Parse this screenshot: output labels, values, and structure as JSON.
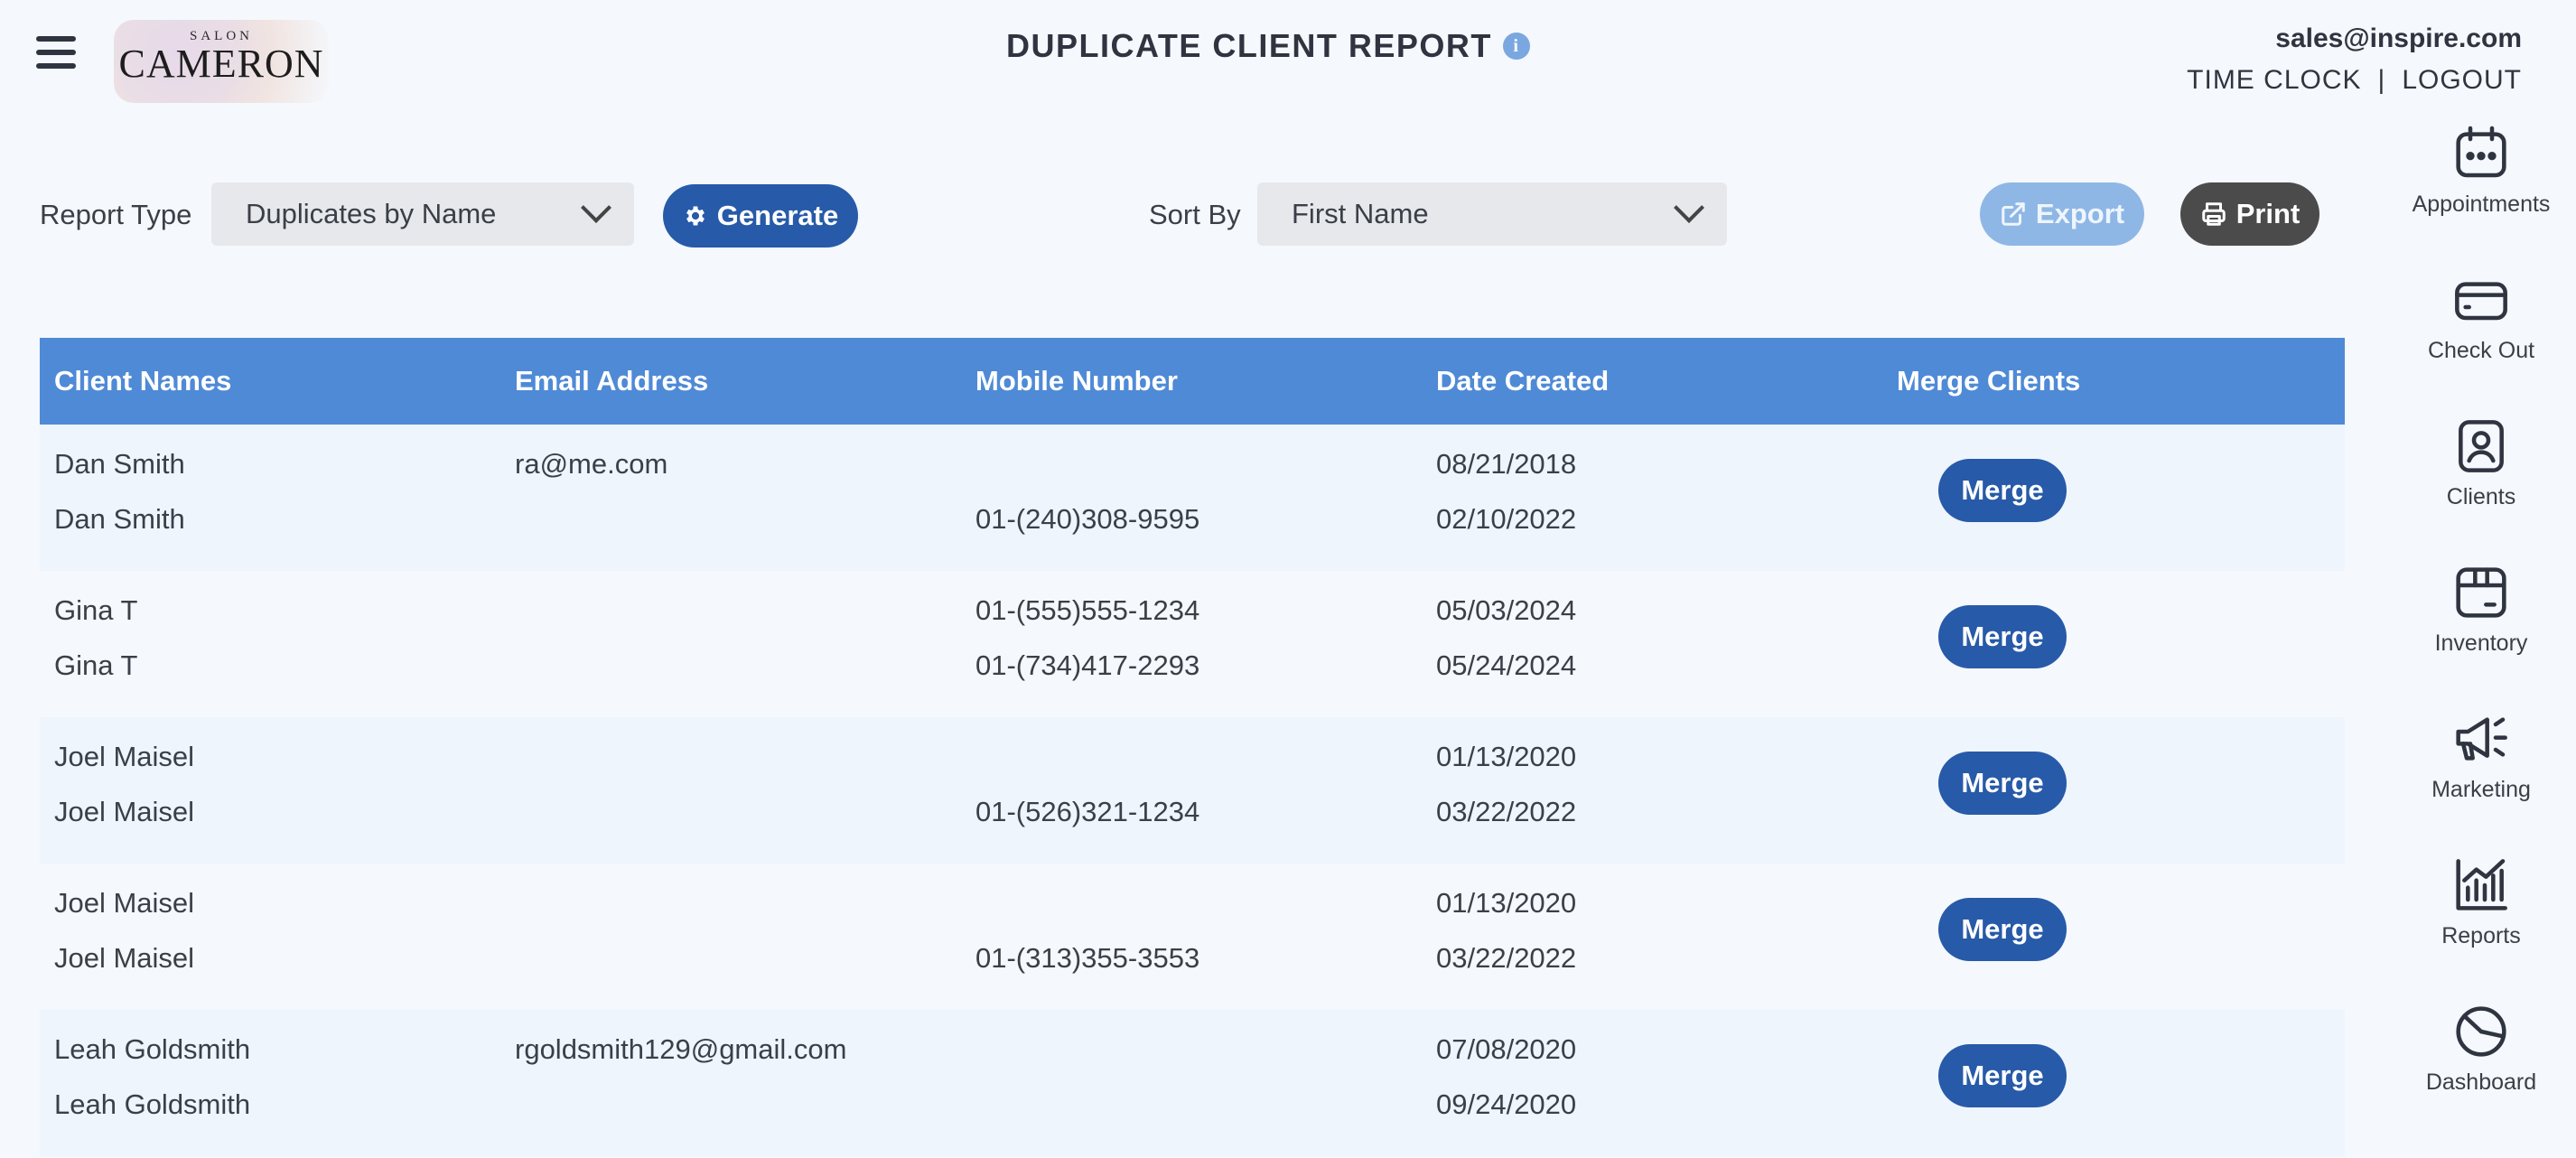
{
  "header": {
    "logo_top": "SALON",
    "logo_main": "CAMERON",
    "title": "DUPLICATE CLIENT REPORT",
    "info_glyph": "i",
    "user_email": "sales@inspire.com",
    "time_clock": "TIME CLOCK",
    "separator": "|",
    "logout": "LOGOUT"
  },
  "controls": {
    "report_type_label": "Report Type",
    "report_type_value": "Duplicates by Name",
    "generate_label": "Generate",
    "sort_by_label": "Sort By",
    "sort_by_value": "First Name",
    "export_label": "Export",
    "print_label": "Print"
  },
  "table": {
    "headers": [
      "Client Names",
      "Email Address",
      "Mobile Number",
      "Date Created",
      "Merge Clients"
    ],
    "merge_label": "Merge",
    "rows": [
      {
        "names": [
          "Dan Smith",
          "Dan Smith"
        ],
        "emails": [
          "ra@me.com",
          ""
        ],
        "mobiles": [
          "",
          "01-(240)308-9595"
        ],
        "dates": [
          "08/21/2018",
          "02/10/2022"
        ]
      },
      {
        "names": [
          "Gina T",
          "Gina T"
        ],
        "emails": [
          "",
          ""
        ],
        "mobiles": [
          "01-(555)555-1234",
          "01-(734)417-2293"
        ],
        "dates": [
          "05/03/2024",
          "05/24/2024"
        ]
      },
      {
        "names": [
          "Joel Maisel",
          "Joel Maisel"
        ],
        "emails": [
          "",
          ""
        ],
        "mobiles": [
          "",
          "01-(526)321-1234"
        ],
        "dates": [
          "01/13/2020",
          "03/22/2022"
        ]
      },
      {
        "names": [
          "Joel Maisel",
          "Joel Maisel"
        ],
        "emails": [
          "",
          ""
        ],
        "mobiles": [
          "",
          "01-(313)355-3553"
        ],
        "dates": [
          "01/13/2020",
          "03/22/2022"
        ]
      },
      {
        "names": [
          "Leah Goldsmith",
          "Leah Goldsmith"
        ],
        "emails": [
          "rgoldsmith129@gmail.com",
          ""
        ],
        "mobiles": [
          "",
          ""
        ],
        "dates": [
          "07/08/2020",
          "09/24/2020"
        ]
      }
    ]
  },
  "sidebar": {
    "items": [
      {
        "label": "Appointments",
        "icon": "calendar-icon"
      },
      {
        "label": "Check Out",
        "icon": "credit-card-icon"
      },
      {
        "label": "Clients",
        "icon": "client-badge-icon"
      },
      {
        "label": "Inventory",
        "icon": "box-icon"
      },
      {
        "label": "Marketing",
        "icon": "megaphone-icon"
      },
      {
        "label": "Reports",
        "icon": "bar-chart-icon"
      },
      {
        "label": "Dashboard",
        "icon": "pie-chart-icon"
      }
    ]
  },
  "colors": {
    "accent": "#275aa8",
    "table_header": "#4f8ad6",
    "row_alt": "#eef5fd",
    "export_button": "#8fb7e5",
    "print_button": "#4b4b4b"
  }
}
